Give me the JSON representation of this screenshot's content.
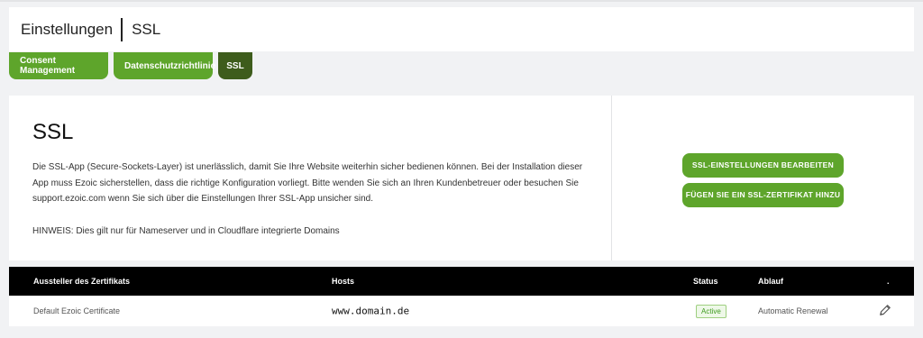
{
  "header": {
    "section": "Einstellungen",
    "page": "SSL"
  },
  "tabs": [
    {
      "label": "Consent Management",
      "active": false
    },
    {
      "label": "Datenschutzrichtlinie",
      "active": false
    },
    {
      "label": "SSL",
      "active": true
    }
  ],
  "panel": {
    "title": "SSL",
    "description": "Die SSL-App (Secure-Sockets-Layer) ist unerlässlich, damit Sie Ihre Website weiterhin sicher bedienen können. Bei der Installation dieser App muss Ezoic sicherstellen, dass die richtige Konfiguration vorliegt. Bitte wenden Sie sich an Ihren Kundenbetreuer oder besuchen Sie support.ezoic.com wenn Sie sich über die Einstellungen Ihrer SSL-App unsicher sind.",
    "note": "HINWEIS: Dies gilt nur für Nameserver und in Cloudflare integrierte Domains",
    "buttons": {
      "edit_settings": "SSL-EINSTELLUNGEN BEARBEITEN",
      "add_certificate": "FÜGEN SIE EIN SSL-ZERTIFIKAT HINZU"
    }
  },
  "table": {
    "columns": {
      "issuer": "Aussteller des Zertifikats",
      "hosts": "Hosts",
      "status": "Status",
      "expiry": "Ablauf",
      "action": "."
    },
    "rows": [
      {
        "issuer": "Default Ezoic Certificate",
        "hosts": "www.domain.de",
        "status": "Active",
        "expiry": "Automatic Renewal",
        "action_icon": "pencil-icon"
      }
    ]
  },
  "colors": {
    "accent": "#5ea52b",
    "tab_active": "#3e5c1c",
    "table_header": "#000000",
    "status_active": "#3f9b1f"
  }
}
